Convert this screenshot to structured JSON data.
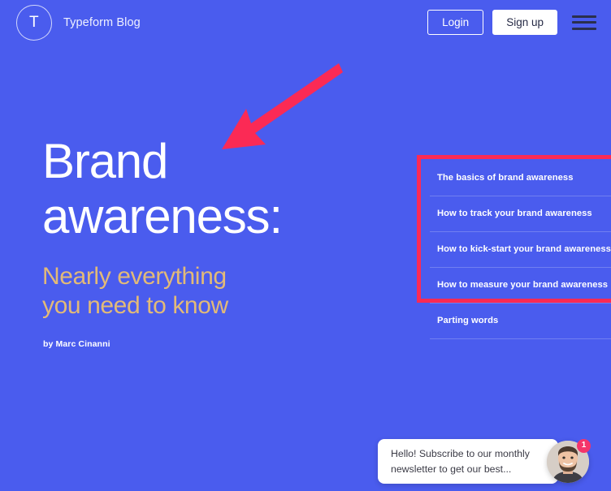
{
  "page": {
    "background_color": "#4a5cee",
    "accent_color": "#e2ba78",
    "annotation_color": "#fb2a55"
  },
  "header": {
    "logo_letter": "T",
    "brand_name": "Typeform Blog",
    "login_label": "Login",
    "signup_label": "Sign up",
    "menu_icon": "hamburger-icon"
  },
  "hero": {
    "title_line1": "Brand",
    "title_line2": "awareness:",
    "subtitle_line1": "Nearly everything",
    "subtitle_line2": "you need to know",
    "byline": "by Marc Cinanni"
  },
  "toc": {
    "items": [
      {
        "label": "The basics of brand awareness"
      },
      {
        "label": "How to track your brand awareness"
      },
      {
        "label": "How to kick-start your brand awareness"
      },
      {
        "label": "How to measure your brand awareness"
      },
      {
        "label": "Parting words"
      }
    ]
  },
  "chat": {
    "message": "Hello! Subscribe to our monthly newsletter to get our best...",
    "unread_count": "1",
    "avatar": "agent-avatar"
  }
}
